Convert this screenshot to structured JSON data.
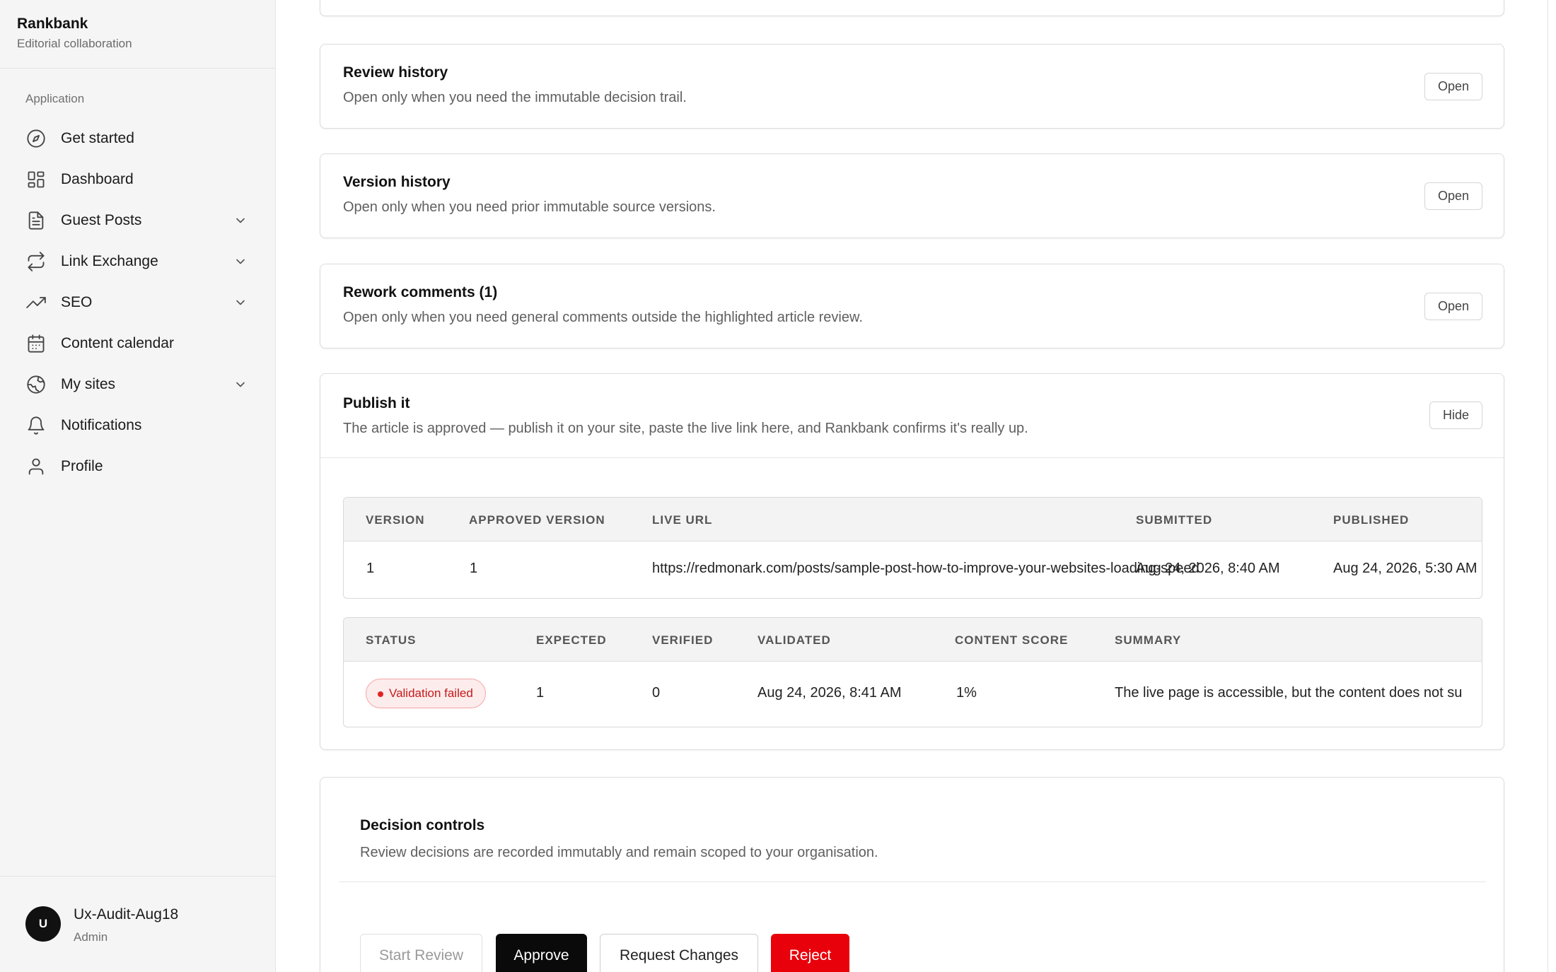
{
  "brand": {
    "name": "Rankbank",
    "subtitle": "Editorial collaboration"
  },
  "sidebar": {
    "section_label": "Application",
    "items": [
      {
        "label": "Get started",
        "icon": "compass-icon",
        "expandable": false
      },
      {
        "label": "Dashboard",
        "icon": "dashboard-icon",
        "expandable": false
      },
      {
        "label": "Guest Posts",
        "icon": "document-icon",
        "expandable": true
      },
      {
        "label": "Link Exchange",
        "icon": "exchange-icon",
        "expandable": true
      },
      {
        "label": "SEO",
        "icon": "trending-up-icon",
        "expandable": true
      },
      {
        "label": "Content calendar",
        "icon": "calendar-icon",
        "expandable": false
      },
      {
        "label": "My sites",
        "icon": "globe-icon",
        "expandable": true
      },
      {
        "label": "Notifications",
        "icon": "bell-icon",
        "expandable": false
      },
      {
        "label": "Profile",
        "icon": "user-icon",
        "expandable": false
      }
    ]
  },
  "user": {
    "initial": "U",
    "name": "Ux-Audit-Aug18",
    "role": "Admin"
  },
  "cards": {
    "review_history": {
      "title": "Review history",
      "description": "Open only when you need the immutable decision trail.",
      "button": "Open"
    },
    "version_history": {
      "title": "Version history",
      "description": "Open only when you need prior immutable source versions.",
      "button": "Open"
    },
    "rework_comments": {
      "title": "Rework comments (1)",
      "description": "Open only when you need general comments outside the highlighted article review.",
      "button": "Open"
    }
  },
  "publish": {
    "title": "Publish it",
    "description": "The article is approved — publish it on your site, paste the live link here, and Rankbank confirms it's really up.",
    "button": "Hide",
    "submission_table": {
      "headers": {
        "version": "VERSION",
        "approved_version": "APPROVED VERSION",
        "live_url": "LIVE URL",
        "submitted": "SUBMITTED",
        "published": "PUBLISHED"
      },
      "row": {
        "version": "1",
        "approved_version": "1",
        "live_url": "https://redmonark.com/posts/sample-post-how-to-improve-your-websites-loading-speed",
        "submitted": "Aug 24, 2026, 8:40 AM",
        "published": "Aug 24, 2026, 5:30 AM"
      }
    },
    "validation_table": {
      "headers": {
        "status": "STATUS",
        "expected": "EXPECTED",
        "verified": "VERIFIED",
        "validated": "VALIDATED",
        "content_score": "CONTENT SCORE",
        "summary": "SUMMARY"
      },
      "row": {
        "status": "Validation failed",
        "expected": "1",
        "verified": "0",
        "validated": "Aug 24, 2026, 8:41 AM",
        "content_score": "1%",
        "summary": "The live page is accessible, but the content does not su"
      }
    }
  },
  "decision": {
    "title": "Decision controls",
    "description": "Review decisions are recorded immutably and remain scoped to your organisation.",
    "buttons": {
      "start_review": "Start Review",
      "approve": "Approve",
      "request_changes": "Request Changes",
      "reject": "Reject"
    }
  },
  "colors": {
    "accent": "#0a0a0a",
    "danger": "#e8000b",
    "link": "#1a4ee0",
    "badge_bg": "#fdecec",
    "badge_text": "#c61a1a"
  }
}
